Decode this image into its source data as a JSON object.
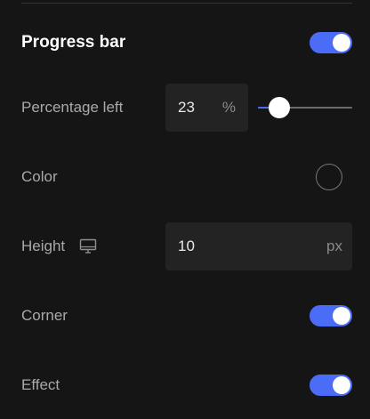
{
  "section": {
    "title": "Progress bar",
    "enabled": true
  },
  "percentage": {
    "label": "Percentage left",
    "value": "23",
    "unit": "%",
    "slider_fraction": 0.23
  },
  "color": {
    "label": "Color",
    "value": "#151515"
  },
  "height": {
    "label": "Height",
    "value": "10",
    "unit": "px",
    "device_icon": "desktop-icon"
  },
  "corner": {
    "label": "Corner",
    "enabled": true
  },
  "effect": {
    "label": "Effect",
    "enabled": true
  },
  "colors": {
    "accent": "#4a6cf7",
    "background": "#151515",
    "input_bg": "#232323"
  }
}
